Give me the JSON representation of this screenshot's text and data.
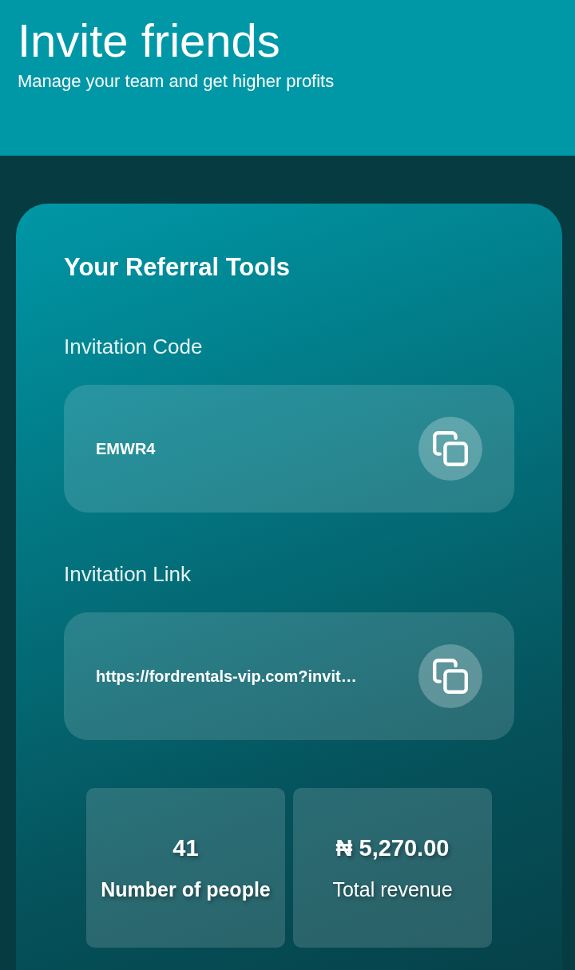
{
  "header": {
    "title": "Invite friends",
    "subtitle": "Manage your team and get higher profits"
  },
  "referral_tools": {
    "title": "Your Referral Tools",
    "fields": [
      {
        "label": "Invitation Code",
        "value": "EMWR4"
      },
      {
        "label": "Invitation Link",
        "value": "https://fordrentals-vip.com?invit…"
      }
    ]
  },
  "stats": [
    {
      "kind": "count",
      "value": "41",
      "label": "Number of people"
    },
    {
      "kind": "revenue",
      "value": "₦ 5,270.00",
      "label": "Total revenue"
    }
  ]
}
